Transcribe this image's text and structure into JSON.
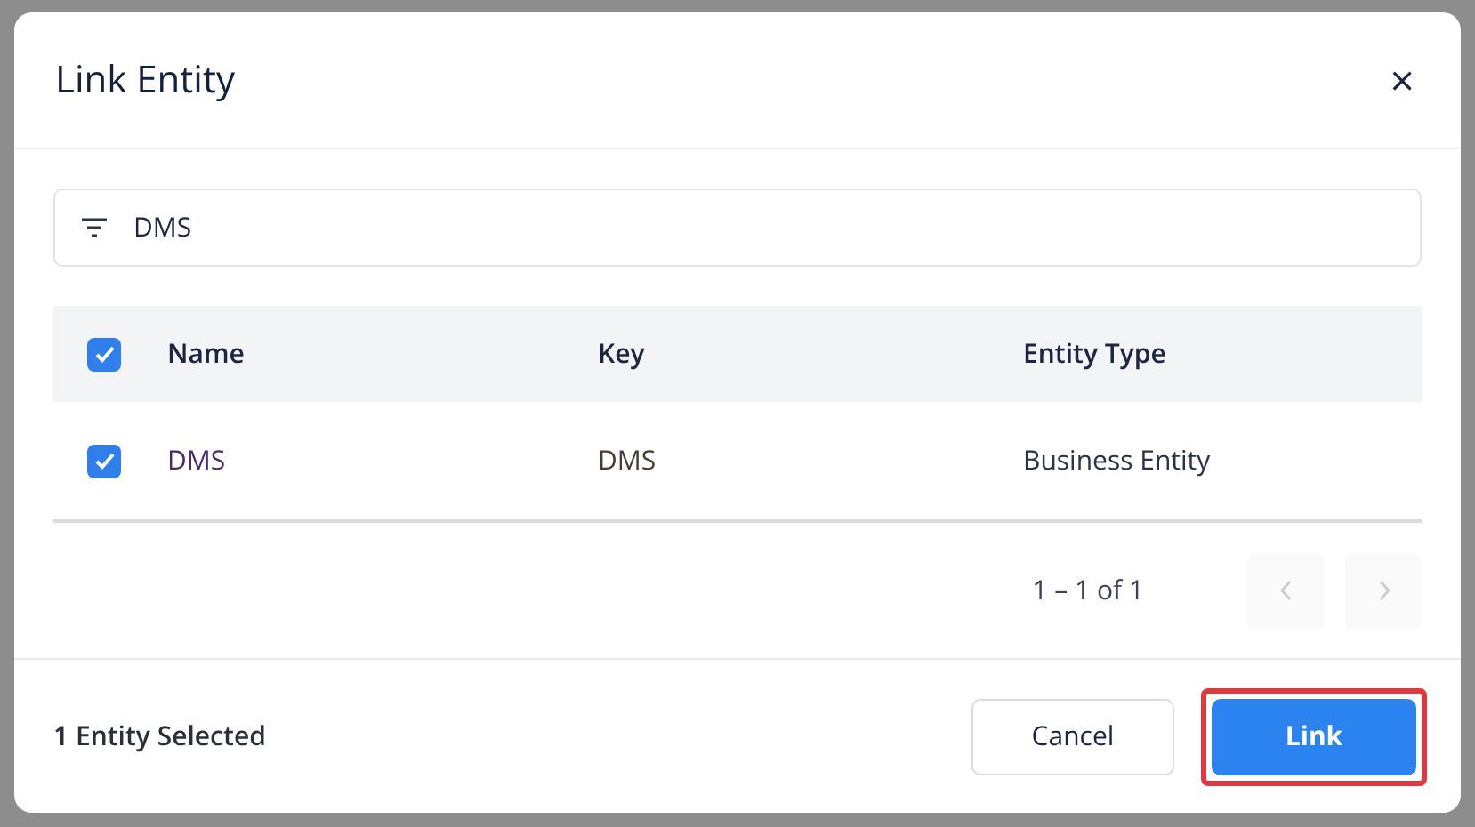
{
  "dialog": {
    "title": "Link Entity",
    "close": "×"
  },
  "filter": {
    "value": "DMS"
  },
  "table": {
    "all_checked": true,
    "columns": [
      "Name",
      "Key",
      "Entity Type"
    ],
    "rows": [
      {
        "checked": true,
        "cells": [
          "DMS",
          "DMS",
          "Business Entity"
        ]
      }
    ]
  },
  "pagination": {
    "range": "1 – 1 of 1",
    "prev_disabled": true,
    "next_disabled": true
  },
  "footer": {
    "selection": "1 Entity Selected",
    "buttons": [
      {
        "label": "Cancel",
        "kind": "secondary",
        "highlighted": false
      },
      {
        "label": "Link",
        "kind": "primary",
        "highlighted": true
      }
    ]
  }
}
